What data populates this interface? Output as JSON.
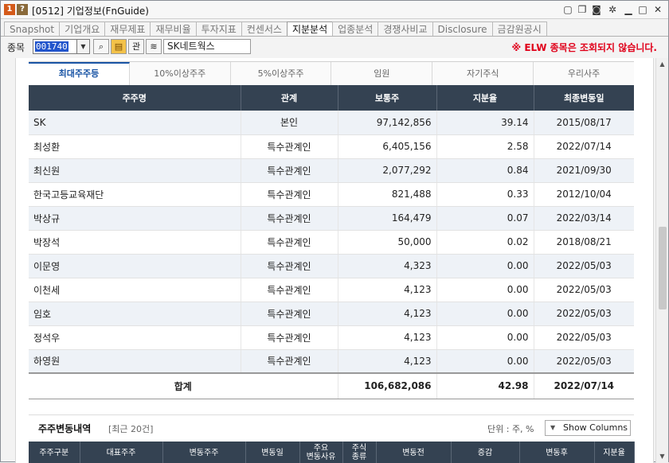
{
  "window": {
    "badge1": "1",
    "badge2": "?",
    "title": "[0512] 기업정보(FnGuide)"
  },
  "title_icons": [
    "layout-icon",
    "copy-icon",
    "camera-icon",
    "gear-icon",
    "minimize-icon",
    "maximize-icon",
    "close-icon"
  ],
  "tabs": [
    {
      "label": "Snapshot",
      "active": false
    },
    {
      "label": "기업개요",
      "active": false
    },
    {
      "label": "재무제표",
      "active": false
    },
    {
      "label": "재무비율",
      "active": false
    },
    {
      "label": "투자지표",
      "active": false
    },
    {
      "label": "컨센서스",
      "active": false
    },
    {
      "label": "지분분석",
      "active": true
    },
    {
      "label": "업종분석",
      "active": false
    },
    {
      "label": "경쟁사비교",
      "active": false
    },
    {
      "label": "Disclosure",
      "active": false
    },
    {
      "label": "금감원공시",
      "active": false
    }
  ],
  "code_row": {
    "label": "종목",
    "code_value": "001740",
    "btn_gwan": "관",
    "company_name": "SK네트웍스",
    "elw_note": "※ ELW 종목은 조회되지 않습니다."
  },
  "subtabs": [
    {
      "label": "최대주주등",
      "active": true
    },
    {
      "label": "10%이상주주",
      "active": false
    },
    {
      "label": "5%이상주주",
      "active": false
    },
    {
      "label": "임원",
      "active": false
    },
    {
      "label": "자기주식",
      "active": false
    },
    {
      "label": "우리사주",
      "active": false
    }
  ],
  "table": {
    "headers": [
      "주주명",
      "관계",
      "보통주",
      "지분율",
      "최종변동일"
    ],
    "rows": [
      [
        "SK",
        "본인",
        "97,142,856",
        "39.14",
        "2015/08/17"
      ],
      [
        "최성환",
        "특수관계인",
        "6,405,156",
        "2.58",
        "2022/07/14"
      ],
      [
        "최신원",
        "특수관계인",
        "2,077,292",
        "0.84",
        "2021/09/30"
      ],
      [
        "한국고등교육재단",
        "특수관계인",
        "821,488",
        "0.33",
        "2012/10/04"
      ],
      [
        "박상규",
        "특수관계인",
        "164,479",
        "0.07",
        "2022/03/14"
      ],
      [
        "박장석",
        "특수관계인",
        "50,000",
        "0.02",
        "2018/08/21"
      ],
      [
        "이문영",
        "특수관계인",
        "4,323",
        "0.00",
        "2022/05/03"
      ],
      [
        "이천세",
        "특수관계인",
        "4,123",
        "0.00",
        "2022/05/03"
      ],
      [
        "임호",
        "특수관계인",
        "4,123",
        "0.00",
        "2022/05/03"
      ],
      [
        "정석우",
        "특수관계인",
        "4,123",
        "0.00",
        "2022/05/03"
      ],
      [
        "하영원",
        "특수관계인",
        "4,123",
        "0.00",
        "2022/05/03"
      ]
    ],
    "total": {
      "label": "합계",
      "shares": "106,682,086",
      "ratio": "42.98",
      "date": "2022/07/14"
    }
  },
  "change_section": {
    "title": "주주변동내역",
    "subtitle": "[최근 20건]",
    "unit": "단위 : 주, %",
    "show_columns": "Show Columns",
    "headers": [
      "주주구분",
      "대표주주",
      "변동주주",
      "변동일",
      "주요\n변동사유",
      "주식\n종류",
      "변동전",
      "증감",
      "변동후",
      "지분율"
    ]
  }
}
